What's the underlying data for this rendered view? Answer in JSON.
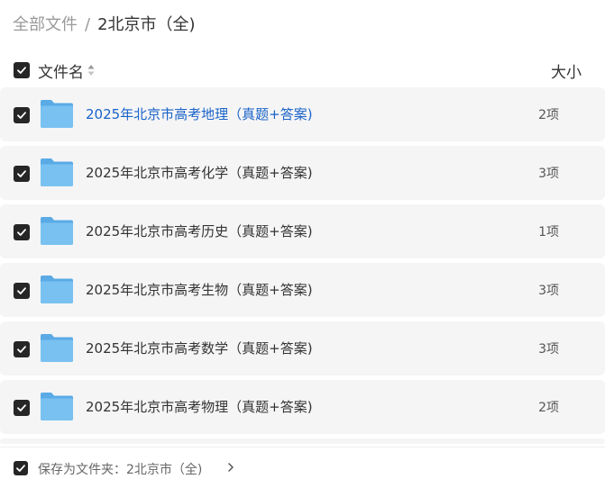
{
  "breadcrumb": {
    "root": "全部文件",
    "separator": "/",
    "current": "2北京市（全)"
  },
  "header": {
    "name_label": "文件名",
    "size_label": "大小",
    "select_all_checked": true
  },
  "files": [
    {
      "name": "2025年北京市高考地理（真题+答案)",
      "count": "2项",
      "checked": true,
      "active": true
    },
    {
      "name": "2025年北京市高考化学（真题+答案)",
      "count": "3项",
      "checked": true,
      "active": false
    },
    {
      "name": "2025年北京市高考历史（真题+答案)",
      "count": "1项",
      "checked": true,
      "active": false
    },
    {
      "name": "2025年北京市高考生物（真题+答案)",
      "count": "3项",
      "checked": true,
      "active": false
    },
    {
      "name": "2025年北京市高考数学（真题+答案)",
      "count": "3项",
      "checked": true,
      "active": false
    },
    {
      "name": "2025年北京市高考物理（真题+答案)",
      "count": "2项",
      "checked": true,
      "active": false
    }
  ],
  "footer": {
    "save_label": "保存为文件夹：2北京市（全)",
    "checked": true
  },
  "colors": {
    "accent": "#1a63c9",
    "folder": "#6db8ee",
    "row_bg": "#f5f5f6",
    "checkbox": "#262626"
  }
}
